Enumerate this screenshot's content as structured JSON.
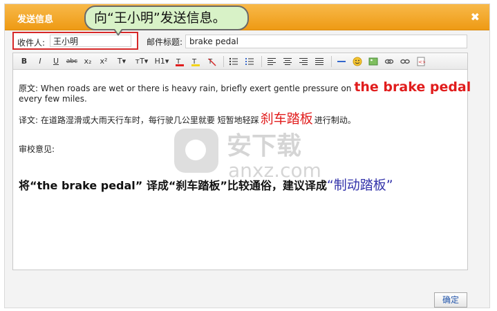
{
  "dialog": {
    "title": "发送信息",
    "close_glyph": "✖"
  },
  "callout": {
    "text": "向“王小明”发送信息。"
  },
  "recipient": {
    "label": "收件人:",
    "value": "王小明"
  },
  "subject": {
    "label": "邮件标题:",
    "value": "brake pedal"
  },
  "toolbar": {
    "bold": "B",
    "italic": "I",
    "underline": "U",
    "strikethrough": "abc",
    "subscript": "x₂",
    "superscript": "x²",
    "font_family": "T▾",
    "font_size": "тT▾",
    "heading": "H1▾",
    "icons": [
      "text-color-icon",
      "highlight-color-icon",
      "clear-format-icon",
      "unordered-list-icon",
      "ordered-list-icon",
      "align-left-icon",
      "align-center-icon",
      "align-right-icon",
      "align-justify-icon",
      "horizontal-rule-icon",
      "emoticon-icon",
      "image-icon",
      "link-icon",
      "unlink-icon",
      "source-code-icon"
    ]
  },
  "content": {
    "line1_prefix": "原文: When roads are wet or there is heavy rain, briefly exert gentle pressure on",
    "line1_highlight": "the brake pedal",
    "line2": "every few miles.",
    "line3_prefix": "译文: 在道路湿滑或大雨天行车时，每行驶几公里就要 短暂地轻踩",
    "line3_highlight": "刹车踏板",
    "line3_suffix": "进行制动。",
    "review_label": "审校意见:",
    "note_prefix": "将“the brake pedal” 译成“刹车踏板”比较通俗，建议译成",
    "note_blue": "“制动踏板”"
  },
  "watermark": {
    "title": "安下载",
    "url": "anxz.com"
  },
  "confirm_label": "确定",
  "colors": {
    "titlebar": "#ee9a14",
    "highlight_red": "#e11d1d",
    "note_blue": "#3333aa",
    "callout_green": "#d8f2c7"
  }
}
